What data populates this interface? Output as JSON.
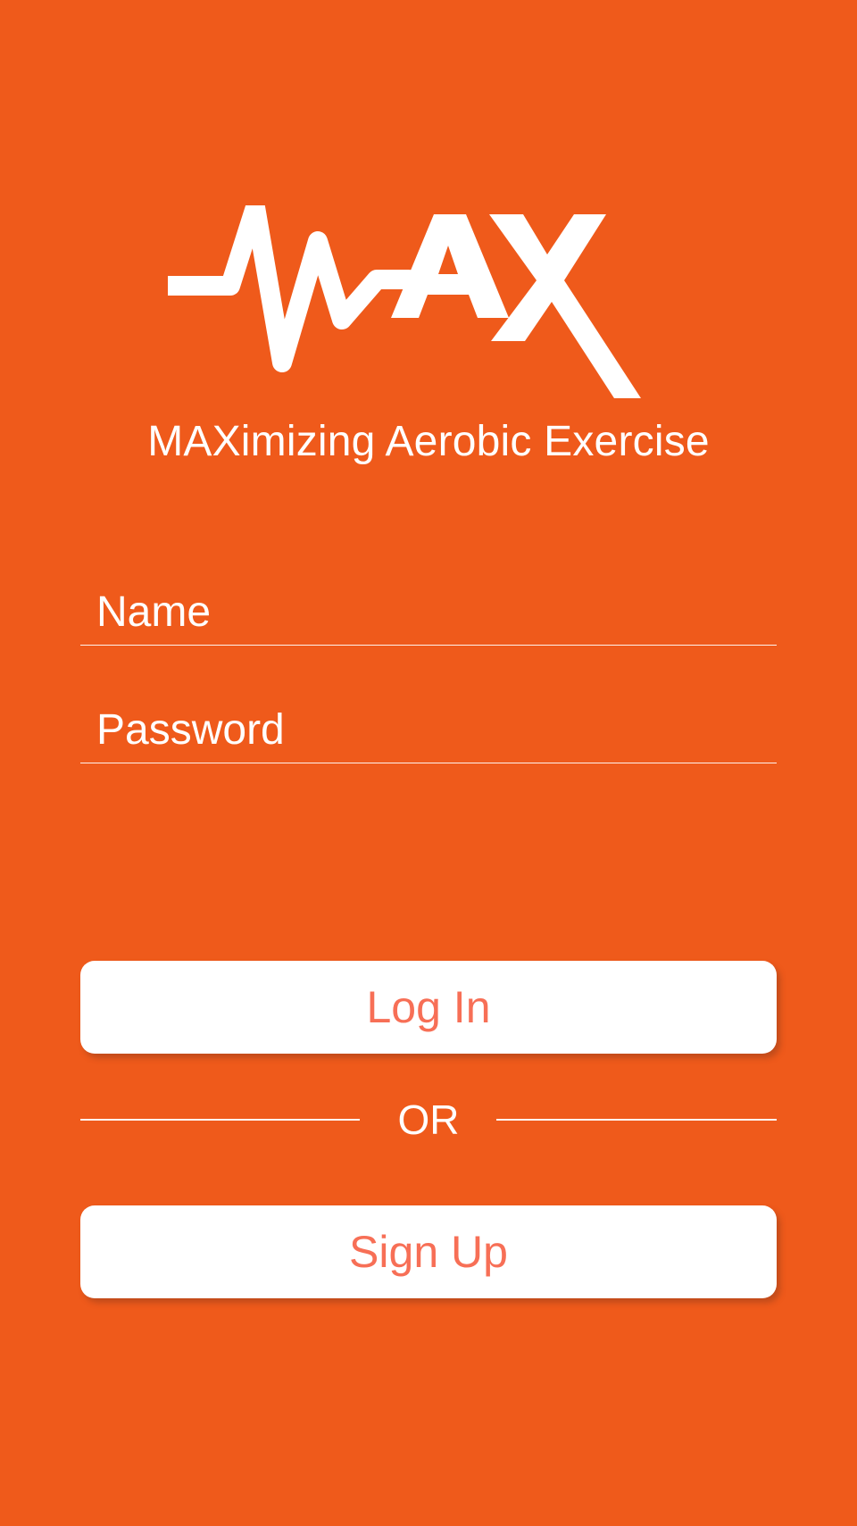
{
  "brand": {
    "logo_text": "MAX",
    "tagline": "MAXimizing Aerobic Exercise",
    "logo_icon": "heartbeat-max-logo-icon"
  },
  "form": {
    "name_placeholder": "Name",
    "password_placeholder": "Password"
  },
  "actions": {
    "login_label": "Log In",
    "separator_label": "OR",
    "signup_label": "Sign Up"
  },
  "colors": {
    "background": "#ef5a1b",
    "button_background": "#ffffff",
    "button_text": "#f76f56",
    "primary_text": "#ffffff"
  }
}
